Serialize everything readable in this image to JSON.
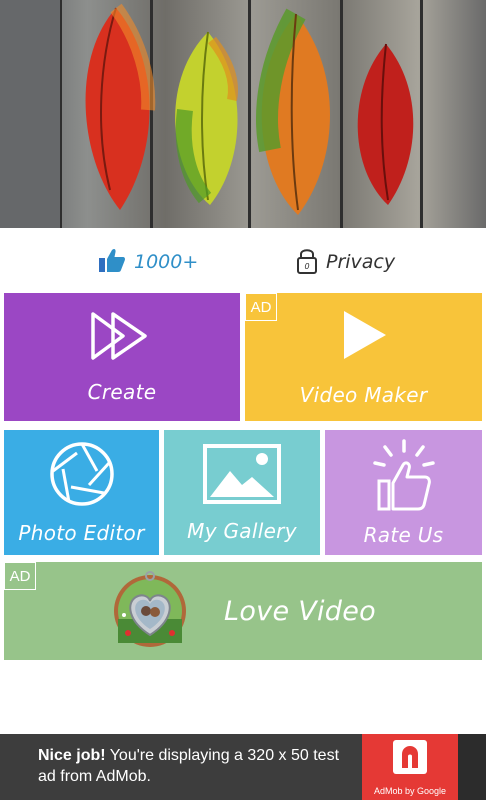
{
  "header": {
    "image": "autumn-leaves-on-wood"
  },
  "stats": {
    "likes": {
      "icon": "thumbs-up-icon",
      "label": "1000+"
    },
    "privacy": {
      "icon": "lock-icon",
      "label": "Privacy"
    }
  },
  "tiles": {
    "create": {
      "label": "Create",
      "icon": "fast-forward-icon",
      "color": "#9b47c4"
    },
    "video_maker": {
      "label": "Video Maker",
      "ad": "AD",
      "icon": "play-icon",
      "color": "#f8c43a"
    },
    "photo_editor": {
      "label": "Photo Editor",
      "icon": "camera-aperture-icon",
      "color": "#3aade5"
    },
    "my_gallery": {
      "label": "My Gallery",
      "icon": "image-icon",
      "color": "#78cdd0"
    },
    "rate_us": {
      "label": "Rate Us",
      "icon": "thumbs-up-icon",
      "color": "#c896e0"
    },
    "love_video": {
      "label": "Love Video",
      "ad": "AD",
      "icon": "heart-photo-locket",
      "color": "#97c48a"
    }
  },
  "ad_banner": {
    "headline": "Nice job!",
    "body": "You're displaying a 320 x 50 test ad from AdMob.",
    "brand": "AdMob by Google"
  }
}
